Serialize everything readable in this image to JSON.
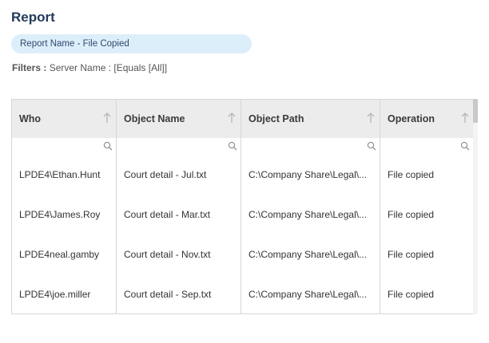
{
  "page": {
    "title": "Report",
    "report_name": "Report Name - File Copied",
    "filters_label": "Filters :",
    "filters_value": "Server Name : [Equals [All]]"
  },
  "table": {
    "columns": [
      "Who",
      "Object Name",
      "Object Path",
      "Operation"
    ],
    "rows": [
      [
        "LPDE4\\Ethan.Hunt",
        "Court detail - Jul.txt",
        "C:\\Company Share\\Legal\\...",
        "File copied"
      ],
      [
        "LPDE4\\James.Roy",
        "Court detail - Mar.txt",
        "C:\\Company Share\\Legal\\...",
        "File copied"
      ],
      [
        "LPDE4neal.gamby",
        "Court detail - Nov.txt",
        "C:\\Company Share\\Legal\\...",
        "File copied"
      ],
      [
        "LPDE4\\joe.miller",
        "Court detail - Sep.txt",
        "C:\\Company Share\\Legal\\...",
        "File copied"
      ]
    ]
  },
  "icons": {
    "sort": "sort-arrow-up-icon",
    "filter": "search-icon"
  }
}
